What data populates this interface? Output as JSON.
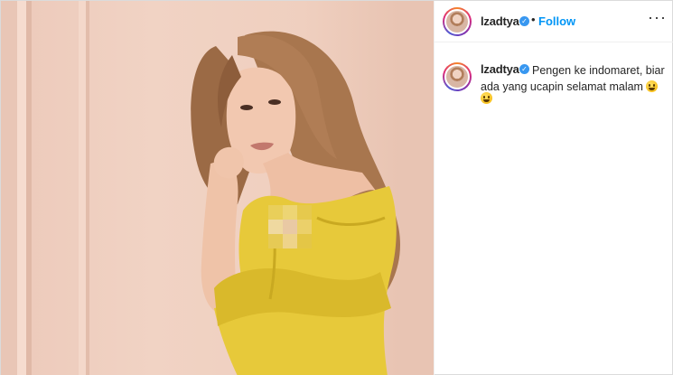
{
  "post": {
    "username": "lzadtya",
    "verified": true,
    "follow_label": "Follow",
    "separator": "•",
    "more_icon": "more-horizontal-icon",
    "caption_text": "Pengen ke indomaret, biar ada yang ucapin selamat malam"
  },
  "colors": {
    "follow_blue": "#0095f6",
    "verified_blue": "#3897f0",
    "outfit_yellow": "#e7c93a",
    "wall_pink": "#efcfbf"
  },
  "icons": [
    "verified-badge-icon",
    "more-horizontal-icon",
    "grimace-emoji-icon",
    "grinning-emoji-icon"
  ]
}
